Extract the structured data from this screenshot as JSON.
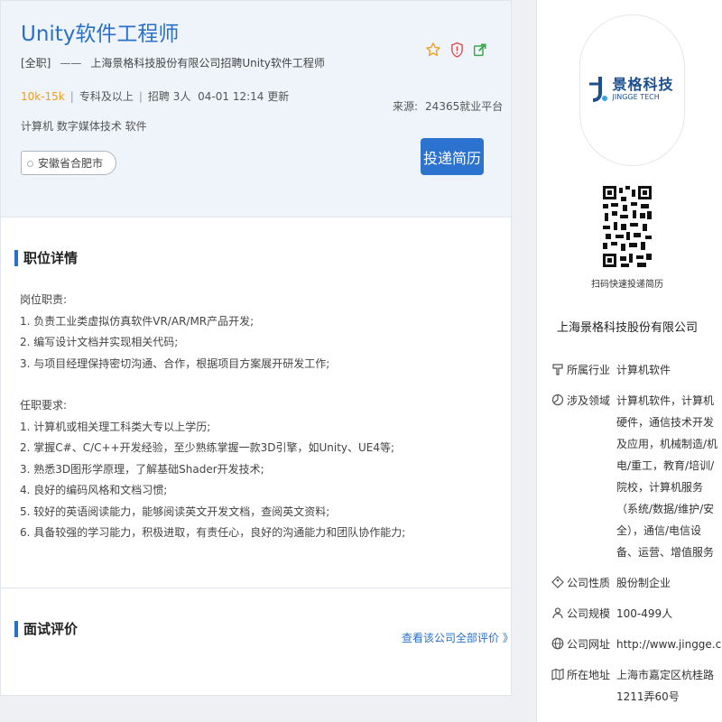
{
  "job": {
    "title": "Unity软件工程师",
    "type_tag": "[全职]",
    "dash": "——",
    "company_recruit_text": "上海景格科技股份有限公司招聘Unity软件工程师",
    "salary": "10k-15k",
    "education": "专科及以上",
    "headcount": "招聘 3人",
    "updated": "04-01 12:14 更新",
    "source_label": "来源:",
    "source_value": "24365就业平台",
    "majors": "计算机 数字媒体技术 软件",
    "location": "安徽省合肥市",
    "apply_label": "投递简历"
  },
  "detail": {
    "section_title": "职位详情",
    "duties_heading": "岗位职责:",
    "duties": [
      "1. 负责工业类虚拟仿真软件VR/AR/MR产品开发;",
      "2. 编写设计文档并实现相关代码;",
      "3. 与项目经理保持密切沟通、合作，根据项目方案展开研发工作;"
    ],
    "requirements_heading": "任职要求:",
    "requirements": [
      "1. 计算机或相关理工科类大专以上学历;",
      "2. 掌握C#、C/C++开发经验，至少熟练掌握一款3D引擎，如Unity、UE4等;",
      "3. 熟悉3D图形学原理，了解基础Shader开发技术;",
      "4. 良好的编码风格和文档习惯;",
      "5. 较好的英语阅读能力，能够阅读英文开发文档，查阅英文资料;",
      "6. 具备较强的学习能力，积极进取，有责任心，良好的沟通能力和团队协作能力;"
    ]
  },
  "review": {
    "section_title": "面试评价",
    "link_label": "查看该公司全部评价 》"
  },
  "sidebar": {
    "logo_cn": "景格科技",
    "logo_en": "JINGGE TECH",
    "qr_label": "扫码快速投递简历",
    "company_name": "上海景格科技股份有限公司",
    "info": [
      {
        "label": "所属行业",
        "value": "计算机软件",
        "icon": "industry-icon"
      },
      {
        "label": "涉及领域",
        "value": "计算机软件，计算机硬件，通信技术开发及应用，机械制造/机电/重工，教育/培训/院校，计算机服务（系统/数据/维护/安全），通信/电信设备、运营、增值服务",
        "icon": "field-icon"
      },
      {
        "label": "公司性质",
        "value": "股份制企业",
        "icon": "nature-icon"
      },
      {
        "label": "公司规模",
        "value": "100-499人",
        "icon": "scale-icon"
      },
      {
        "label": "公司网址",
        "value": "http://www.jingge.com",
        "icon": "website-icon"
      },
      {
        "label": "所在地址",
        "value": "上海市嘉定区杭桂路1211弄60号",
        "icon": "address-icon"
      }
    ]
  },
  "colors": {
    "accent": "#2a70c8",
    "salary": "#f39b1c",
    "button": "#2c72cf"
  }
}
